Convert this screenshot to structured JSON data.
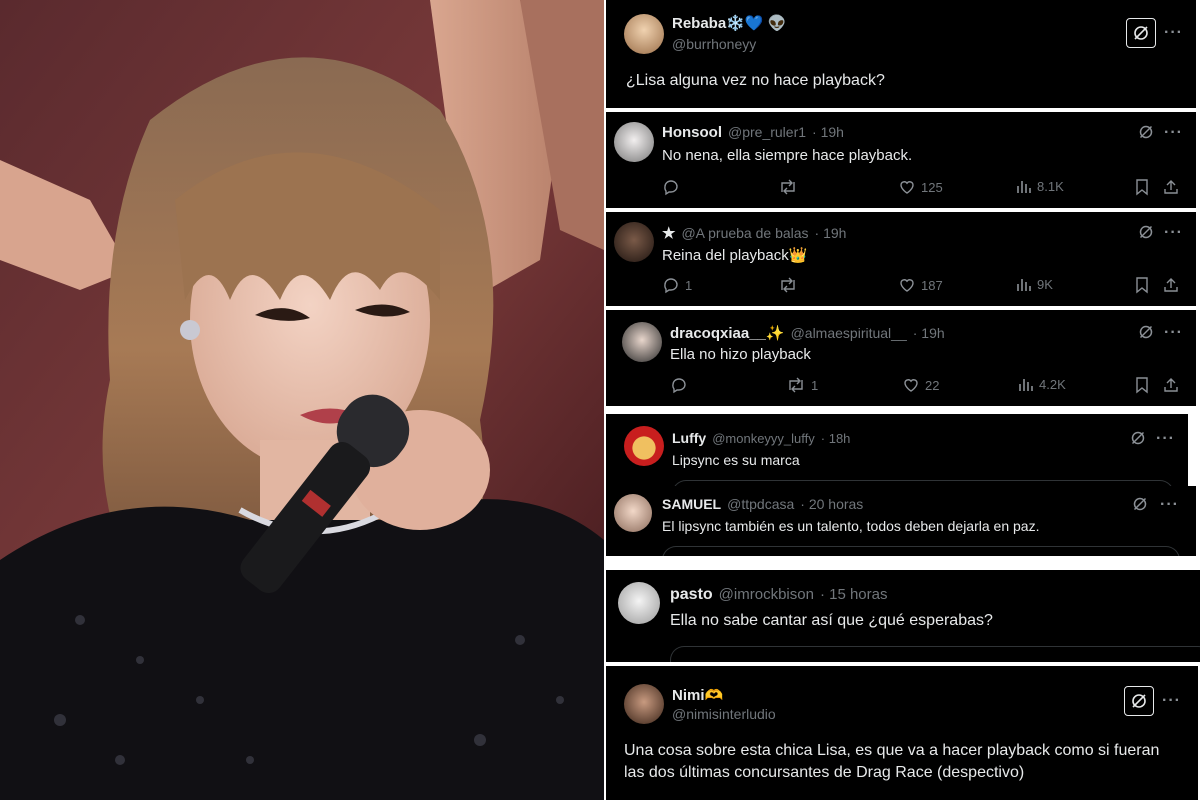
{
  "main_tweet": {
    "display_name": "Rebaba❄️💙 👽",
    "handle": "@burrhoneyy",
    "text": "¿Lisa alguna vez no hace playback?"
  },
  "replies": [
    {
      "display_name": "Honsool",
      "handle": "@pre_ruler1",
      "time": "· 19h",
      "text": "No nena, ella siempre hace playback.",
      "replies": "",
      "reposts": "",
      "likes": "125",
      "views": "8.1K"
    },
    {
      "display_name": "★",
      "handle": "@A prueba de balas",
      "time": "· 19h",
      "text": "Reina del playback👑",
      "replies": "1",
      "reposts": "",
      "likes": "187",
      "views": "9K"
    },
    {
      "display_name": "dracoqxiaa__✨",
      "handle": "@almaespiritual__",
      "time": "· 19h",
      "text": "Ella no hizo playback",
      "replies": "",
      "reposts": "1",
      "likes": "22",
      "views": "4.2K"
    },
    {
      "display_name": "Luffy",
      "handle": "@monkeyyy_luffy",
      "time": "· 18h",
      "text": "Lipsync es su marca"
    },
    {
      "display_name": "SAMUEL",
      "handle": "@ttpdcasa",
      "time": "· 20 horas",
      "text": "El lipsync también es un talento, todos deben dejarla en paz."
    },
    {
      "display_name": "pasto",
      "handle": "@imrockbison",
      "time": "· 15 horas",
      "text": "Ella no sabe cantar así que ¿qué esperabas?"
    }
  ],
  "bottom_tweet": {
    "display_name": "Nimi🫶",
    "handle": "@nimisinterludio",
    "text_line1": "Una cosa sobre esta chica Lisa, es que va a hacer playback como si fueran",
    "text_line2": "las dos últimas concursantes de Drag Race (despectivo)"
  },
  "icons": [
    "grok-icon",
    "more-icon",
    "reply-icon",
    "repost-icon",
    "like-icon",
    "views-icon",
    "bookmark-icon",
    "share-icon"
  ],
  "colors": {
    "background": "#000000",
    "text": "#e7e9ea",
    "muted": "#71767b",
    "divider": "#ffffff"
  }
}
